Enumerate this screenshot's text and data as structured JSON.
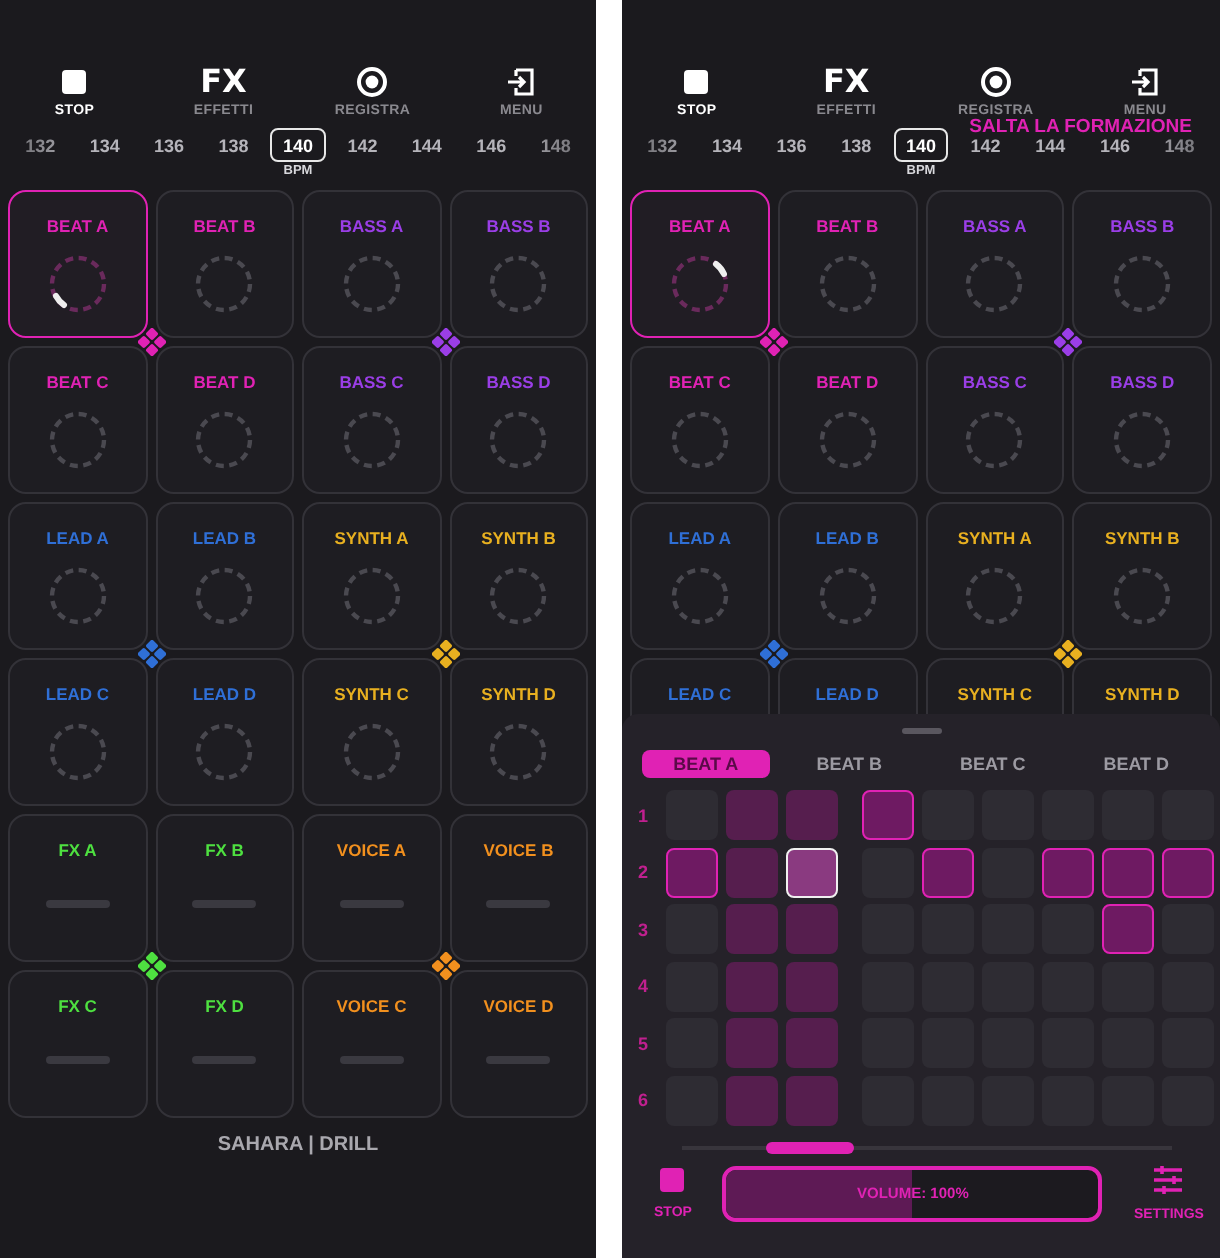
{
  "screens": [
    {
      "toolbar": [
        {
          "kind": "stop",
          "label": "STOP",
          "active": true
        },
        {
          "kind": "fx",
          "icon_text": "FX",
          "label": "EFFETTI",
          "active": false
        },
        {
          "kind": "record",
          "label": "REGISTRA",
          "active": false
        },
        {
          "kind": "menu",
          "label": "MENU",
          "active": false
        }
      ],
      "bpm": {
        "values": [
          {
            "label": "132",
            "selected": false
          },
          {
            "label": "134",
            "selected": false
          },
          {
            "label": "136",
            "selected": false
          },
          {
            "label": "138",
            "selected": false
          },
          {
            "label": "140",
            "selected": true
          },
          {
            "label": "142",
            "selected": false
          },
          {
            "label": "144",
            "selected": false
          },
          {
            "label": "146",
            "selected": false
          },
          {
            "label": "148",
            "selected": false
          }
        ],
        "unit": "BPM"
      },
      "groups": [
        {
          "color": "#e022b4",
          "pads": [
            {
              "label": "BEAT A",
              "kind": "loop",
              "selected": true
            },
            {
              "label": "BEAT B",
              "kind": "loop",
              "selected": false
            },
            {
              "label": "BEAT C",
              "kind": "loop",
              "selected": false
            },
            {
              "label": "BEAT D",
              "kind": "loop",
              "selected": false
            }
          ]
        },
        {
          "color": "#9a3ee6",
          "pads": [
            {
              "label": "BASS A",
              "kind": "loop",
              "selected": false
            },
            {
              "label": "BASS B",
              "kind": "loop",
              "selected": false
            },
            {
              "label": "BASS C",
              "kind": "loop",
              "selected": false
            },
            {
              "label": "BASS D",
              "kind": "loop",
              "selected": false
            }
          ]
        },
        {
          "color": "#2f6fd6",
          "pads": [
            {
              "label": "LEAD A",
              "kind": "loop",
              "selected": false
            },
            {
              "label": "LEAD B",
              "kind": "loop",
              "selected": false
            },
            {
              "label": "LEAD C",
              "kind": "loop",
              "selected": false
            },
            {
              "label": "LEAD D",
              "kind": "loop",
              "selected": false
            }
          ]
        },
        {
          "color": "#e8b020",
          "pads": [
            {
              "label": "SYNTH A",
              "kind": "loop",
              "selected": false
            },
            {
              "label": "SYNTH B",
              "kind": "loop",
              "selected": false
            },
            {
              "label": "SYNTH C",
              "kind": "loop",
              "selected": false
            },
            {
              "label": "SYNTH D",
              "kind": "loop",
              "selected": false
            }
          ]
        },
        {
          "color": "#4ee040",
          "pads": [
            {
              "label": "FX A",
              "kind": "line",
              "selected": false
            },
            {
              "label": "FX B",
              "kind": "line",
              "selected": false
            },
            {
              "label": "FX C",
              "kind": "line",
              "selected": false
            },
            {
              "label": "FX D",
              "kind": "line",
              "selected": false
            }
          ]
        },
        {
          "color": "#f2901e",
          "pads": [
            {
              "label": "VOICE A",
              "kind": "line",
              "selected": false
            },
            {
              "label": "VOICE B",
              "kind": "line",
              "selected": false
            },
            {
              "label": "VOICE C",
              "kind": "line",
              "selected": false
            },
            {
              "label": "VOICE D",
              "kind": "line",
              "selected": false
            }
          ]
        }
      ],
      "footer": "SAHARA | DRILL"
    },
    {
      "toolbar": [
        {
          "kind": "stop",
          "label": "STOP",
          "active": true
        },
        {
          "kind": "fx",
          "icon_text": "FX",
          "label": "EFFETTI",
          "active": false
        },
        {
          "kind": "record",
          "label": "REGISTRA",
          "active": false
        },
        {
          "kind": "menu",
          "label": "MENU",
          "active": false
        }
      ],
      "banner": "SALTA LA FORMAZIONE",
      "bpm": {
        "values": [
          {
            "label": "132",
            "selected": false
          },
          {
            "label": "134",
            "selected": false
          },
          {
            "label": "136",
            "selected": false
          },
          {
            "label": "138",
            "selected": false
          },
          {
            "label": "140",
            "selected": true
          },
          {
            "label": "142",
            "selected": false
          },
          {
            "label": "144",
            "selected": false
          },
          {
            "label": "146",
            "selected": false
          },
          {
            "label": "148",
            "selected": false
          }
        ],
        "unit": "BPM"
      },
      "groups": [
        {
          "color": "#e022b4",
          "pads": [
            {
              "label": "BEAT A",
              "kind": "loop",
              "selected": true
            },
            {
              "label": "BEAT B",
              "kind": "loop",
              "selected": false
            },
            {
              "label": "BEAT C",
              "kind": "loop",
              "selected": false
            },
            {
              "label": "BEAT D",
              "kind": "loop",
              "selected": false
            }
          ]
        },
        {
          "color": "#9a3ee6",
          "pads": [
            {
              "label": "BASS A",
              "kind": "loop",
              "selected": false
            },
            {
              "label": "BASS B",
              "kind": "loop",
              "selected": false
            },
            {
              "label": "BASS C",
              "kind": "loop",
              "selected": false
            },
            {
              "label": "BASS D",
              "kind": "loop",
              "selected": false
            }
          ]
        },
        {
          "color": "#2f6fd6",
          "pads": [
            {
              "label": "LEAD A",
              "kind": "loop",
              "selected": false
            },
            {
              "label": "LEAD B",
              "kind": "loop",
              "selected": false
            },
            {
              "label": "LEAD C",
              "selected": false
            },
            {
              "label": "LEAD D",
              "selected": false
            }
          ]
        },
        {
          "color": "#e8b020",
          "pads": [
            {
              "label": "SYNTH A",
              "kind": "loop",
              "selected": false
            },
            {
              "label": "SYNTH B",
              "kind": "loop",
              "selected": false
            },
            {
              "label": "SYNTH C",
              "selected": false
            },
            {
              "label": "SYNTH D",
              "selected": false
            }
          ]
        }
      ],
      "sequencer": {
        "tabs": [
          {
            "label": "BEAT A",
            "selected": true
          },
          {
            "label": "BEAT B",
            "selected": false
          },
          {
            "label": "BEAT C",
            "selected": false
          },
          {
            "label": "BEAT D",
            "selected": false
          }
        ],
        "rows": [
          {
            "label": "1",
            "steps": [
              {
                "on": false,
                "current": false,
                "shaded": false
              },
              {
                "on": false,
                "current": false,
                "shaded": true
              },
              {
                "on": false,
                "current": false,
                "shaded": true
              },
              {
                "on": true,
                "current": false,
                "shaded": false
              },
              {
                "on": false,
                "current": false,
                "shaded": false
              },
              {
                "on": false,
                "current": false,
                "shaded": false
              },
              {
                "on": false,
                "current": false,
                "shaded": false
              },
              {
                "on": false,
                "current": false,
                "shaded": false
              },
              {
                "on": false,
                "current": false,
                "shaded": false
              }
            ]
          },
          {
            "label": "2",
            "steps": [
              {
                "on": true,
                "current": false,
                "shaded": false
              },
              {
                "on": false,
                "current": false,
                "shaded": true
              },
              {
                "on": true,
                "current": true,
                "shaded": true
              },
              {
                "on": false,
                "current": false,
                "shaded": false
              },
              {
                "on": true,
                "current": false,
                "shaded": false
              },
              {
                "on": false,
                "current": false,
                "shaded": false
              },
              {
                "on": true,
                "current": false,
                "shaded": false
              },
              {
                "on": true,
                "current": false,
                "shaded": false
              },
              {
                "on": true,
                "current": false,
                "shaded": false
              }
            ]
          },
          {
            "label": "3",
            "steps": [
              {
                "on": false,
                "current": false,
                "shaded": false
              },
              {
                "on": false,
                "current": false,
                "shaded": true
              },
              {
                "on": false,
                "current": false,
                "shaded": true
              },
              {
                "on": false,
                "current": false,
                "shaded": false
              },
              {
                "on": false,
                "current": false,
                "shaded": false
              },
              {
                "on": false,
                "current": false,
                "shaded": false
              },
              {
                "on": false,
                "current": false,
                "shaded": false
              },
              {
                "on": true,
                "current": false,
                "shaded": false
              },
              {
                "on": false,
                "current": false,
                "shaded": false
              }
            ]
          },
          {
            "label": "4",
            "steps": [
              {
                "on": false,
                "current": false,
                "shaded": false
              },
              {
                "on": false,
                "current": false,
                "shaded": true
              },
              {
                "on": false,
                "current": false,
                "shaded": true
              },
              {
                "on": false,
                "current": false,
                "shaded": false
              },
              {
                "on": false,
                "current": false,
                "shaded": false
              },
              {
                "on": false,
                "current": false,
                "shaded": false
              },
              {
                "on": false,
                "current": false,
                "shaded": false
              },
              {
                "on": false,
                "current": false,
                "shaded": false
              },
              {
                "on": false,
                "current": false,
                "shaded": false
              }
            ]
          },
          {
            "label": "5",
            "steps": [
              {
                "on": false,
                "current": false,
                "shaded": false
              },
              {
                "on": false,
                "current": false,
                "shaded": true
              },
              {
                "on": false,
                "current": false,
                "shaded": true
              },
              {
                "on": false,
                "current": false,
                "shaded": false
              },
              {
                "on": false,
                "current": false,
                "shaded": false
              },
              {
                "on": false,
                "current": false,
                "shaded": false
              },
              {
                "on": false,
                "current": false,
                "shaded": false
              },
              {
                "on": false,
                "current": false,
                "shaded": false
              },
              {
                "on": false,
                "current": false,
                "shaded": false
              }
            ]
          },
          {
            "label": "6",
            "steps": [
              {
                "on": false,
                "current": false,
                "shaded": false
              },
              {
                "on": false,
                "current": false,
                "shaded": true
              },
              {
                "on": false,
                "current": false,
                "shaded": true
              },
              {
                "on": false,
                "current": false,
                "shaded": false
              },
              {
                "on": false,
                "current": false,
                "shaded": false
              },
              {
                "on": false,
                "current": false,
                "shaded": false
              },
              {
                "on": false,
                "current": false,
                "shaded": false
              },
              {
                "on": false,
                "current": false,
                "shaded": false
              },
              {
                "on": false,
                "current": false,
                "shaded": false
              }
            ]
          }
        ],
        "stop_label": "STOP",
        "volume": {
          "label": "VOLUME: 100%",
          "level": 0.5
        },
        "settings_label": "SETTINGS"
      }
    }
  ]
}
